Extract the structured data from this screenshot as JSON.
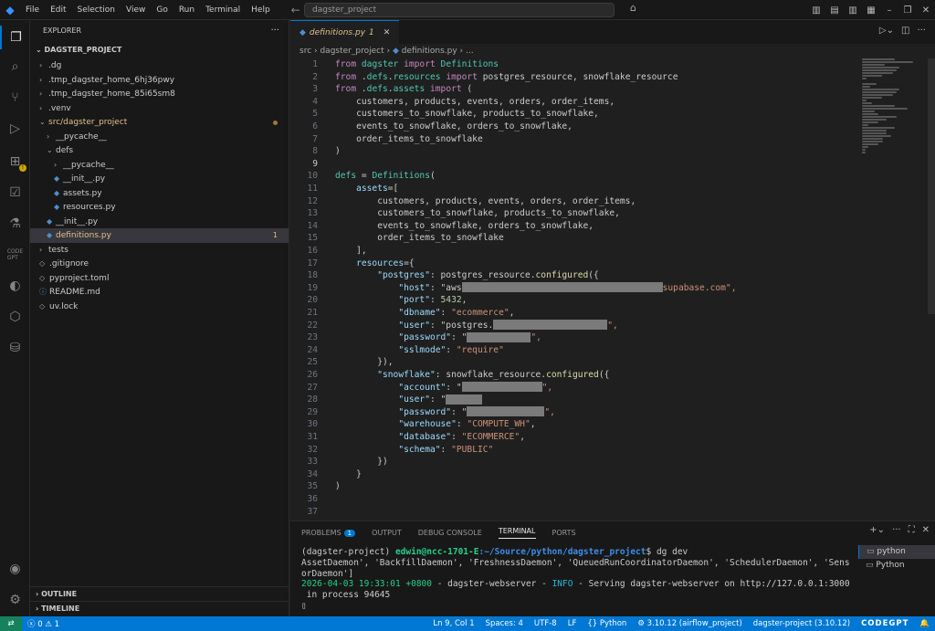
{
  "titlebar": {
    "menu": [
      "File",
      "Edit",
      "Selection",
      "View",
      "Go",
      "Run",
      "Terminal",
      "Help"
    ],
    "search": "dagster_project"
  },
  "sidebar": {
    "header": "EXPLORER",
    "project": "DAGSTER_PROJECT",
    "tree": [
      {
        "label": ".dg",
        "indent": 0,
        "type": "folder"
      },
      {
        "label": ".tmp_dagster_home_6hj36pwy",
        "indent": 0,
        "type": "folder"
      },
      {
        "label": ".tmp_dagster_home_85i65sm8",
        "indent": 0,
        "type": "folder"
      },
      {
        "label": ".venv",
        "indent": 0,
        "type": "folder"
      },
      {
        "label": "src/dagster_project",
        "indent": 0,
        "type": "open",
        "mod": true,
        "dot": true
      },
      {
        "label": "__pycache__",
        "indent": 1,
        "type": "folder"
      },
      {
        "label": "defs",
        "indent": 1,
        "type": "open"
      },
      {
        "label": "__pycache__",
        "indent": 2,
        "type": "folder"
      },
      {
        "label": "__init__.py",
        "indent": 2,
        "type": "py"
      },
      {
        "label": "assets.py",
        "indent": 2,
        "type": "py"
      },
      {
        "label": "resources.py",
        "indent": 2,
        "type": "py"
      },
      {
        "label": "__init__.py",
        "indent": 1,
        "type": "py"
      },
      {
        "label": "definitions.py",
        "indent": 1,
        "type": "py",
        "mod": true,
        "sel": true,
        "badge": "1"
      },
      {
        "label": "tests",
        "indent": 0,
        "type": "folder"
      },
      {
        "label": ".gitignore",
        "indent": 0,
        "type": "file"
      },
      {
        "label": "pyproject.toml",
        "indent": 0,
        "type": "file"
      },
      {
        "label": "README.md",
        "indent": 0,
        "type": "info"
      },
      {
        "label": "uv.lock",
        "indent": 0,
        "type": "file"
      }
    ],
    "outline": "OUTLINE",
    "timeline": "TIMELINE"
  },
  "editor": {
    "tab": "definitions.py",
    "tab_badge": "1",
    "breadcrumb": [
      "src",
      "dagster_project",
      "definitions.py",
      "..."
    ]
  },
  "panel": {
    "tabs": [
      "PROBLEMS",
      "OUTPUT",
      "DEBUG CONSOLE",
      "TERMINAL",
      "PORTS"
    ],
    "problems_count": "1",
    "terminals": [
      "python",
      "Python"
    ]
  },
  "terminal": {
    "prompt_env": "(dagster-project) ",
    "prompt_user": "edwin@ncc-1701-E",
    "prompt_path": ":~/Source/python/dagster_project",
    "prompt_cmd": "$ dg dev",
    "line2": "AssetDaemon', 'BackfillDaemon', 'FreshnessDaemon', 'QueuedRunCoordinatorDaemon', 'SchedulerDaemon', 'Sens",
    "line3": "orDaemon']",
    "line4_ts": "2026-04-03 19:33:01 +0800",
    "line4_mid": " - dagster-webserver - ",
    "line4_lvl": "INFO",
    "line4_rest": " - Serving dagster-webserver on http://127.0.0.1:3000",
    "line5": " in process 94645"
  },
  "status": {
    "errors": "0",
    "warnings": "1",
    "position": "Ln 9, Col 1",
    "spaces": "Spaces: 4",
    "encoding": "UTF-8",
    "eol": "LF",
    "language": "Python",
    "interpreter": "3.10.12 (airflow_project)",
    "env": "dagster-project (3.10.12)",
    "brand": "CODEGPT"
  },
  "code": [
    "from dagster import Definitions",
    "from .defs.resources import postgres_resource, snowflake_resource",
    "from .defs.assets import (",
    "    customers, products, events, orders, order_items,",
    "    customers_to_snowflake, products_to_snowflake,",
    "    events_to_snowflake, orders_to_snowflake,",
    "    order_items_to_snowflake",
    ")",
    "",
    "defs = Definitions(",
    "    assets=[",
    "        customers, products, events, orders, order_items,",
    "        customers_to_snowflake, products_to_snowflake,",
    "        events_to_snowflake, orders_to_snowflake,",
    "        order_items_to_snowflake",
    "    ],",
    "    resources={",
    "        \"postgres\": postgres_resource.configured({",
    "            \"host\": \"aws",
    "            \"port\": 5432,",
    "            \"dbname\": \"ecommerce\",",
    "            \"user\": \"postgres.",
    "            \"password\": \"",
    "            \"sslmode\": \"require\"",
    "        }),",
    "        \"snowflake\": snowflake_resource.configured({",
    "            \"account\": \"",
    "            \"user\": \"",
    "            \"password\": \"",
    "            \"warehouse\": \"COMPUTE_WH\",",
    "            \"database\": \"ECOMMERCE\",",
    "            \"schema\": \"PUBLIC\"",
    "        })",
    "    }",
    ")",
    "",
    ""
  ],
  "code_fragments": {
    "host_tail": "supabase.com\",",
    "user_tail": "\",",
    "pw_tail": "\","
  }
}
